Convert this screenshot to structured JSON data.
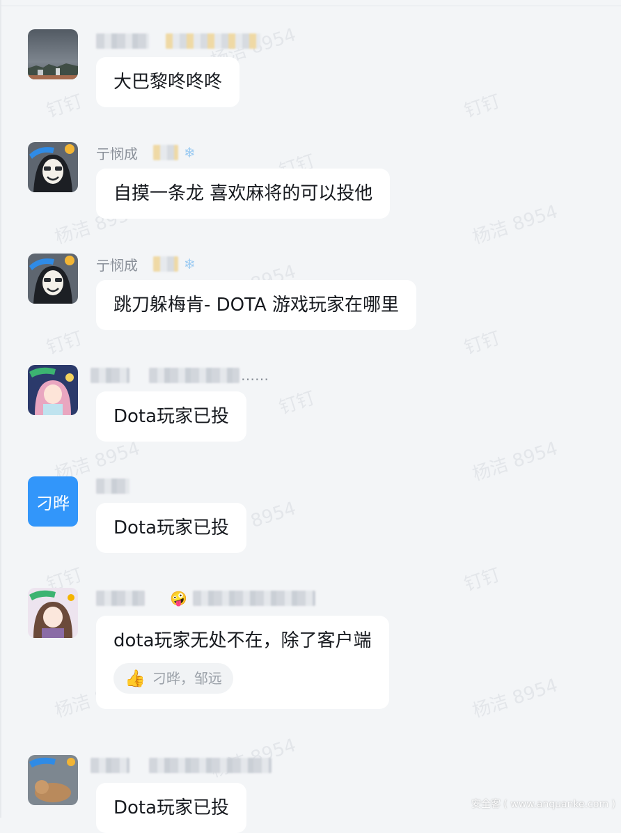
{
  "watermark": {
    "name_text": "杨洁 8954",
    "app_text": "钉钉"
  },
  "messages": [
    {
      "sender": "",
      "text": "大巴黎咚咚咚"
    },
    {
      "sender": "亍悯成",
      "text": "自摸一条龙 喜欢麻将的可以投他"
    },
    {
      "sender": "亍悯成",
      "text": "跳刀躲梅肯- DOTA 游戏玩家在哪里"
    },
    {
      "sender": "",
      "signature_suffix": "……",
      "text": "Dota玩家已投"
    },
    {
      "sender": "",
      "avatar_text": "刁晔",
      "text": "Dota玩家已投"
    },
    {
      "sender": "",
      "text": "dota玩家无处不在，除了客户端",
      "reaction": {
        "icon": "thumbs-up-icon",
        "names": "刁晔，邹远"
      }
    },
    {
      "sender": "",
      "text": "Dota玩家已投"
    }
  ],
  "footer": {
    "credit": "安全客 ( www.anquanke.com )"
  },
  "colors": {
    "background": "#f3f5f7",
    "bubble": "#ffffff",
    "avatar_blue": "#3296fa"
  }
}
